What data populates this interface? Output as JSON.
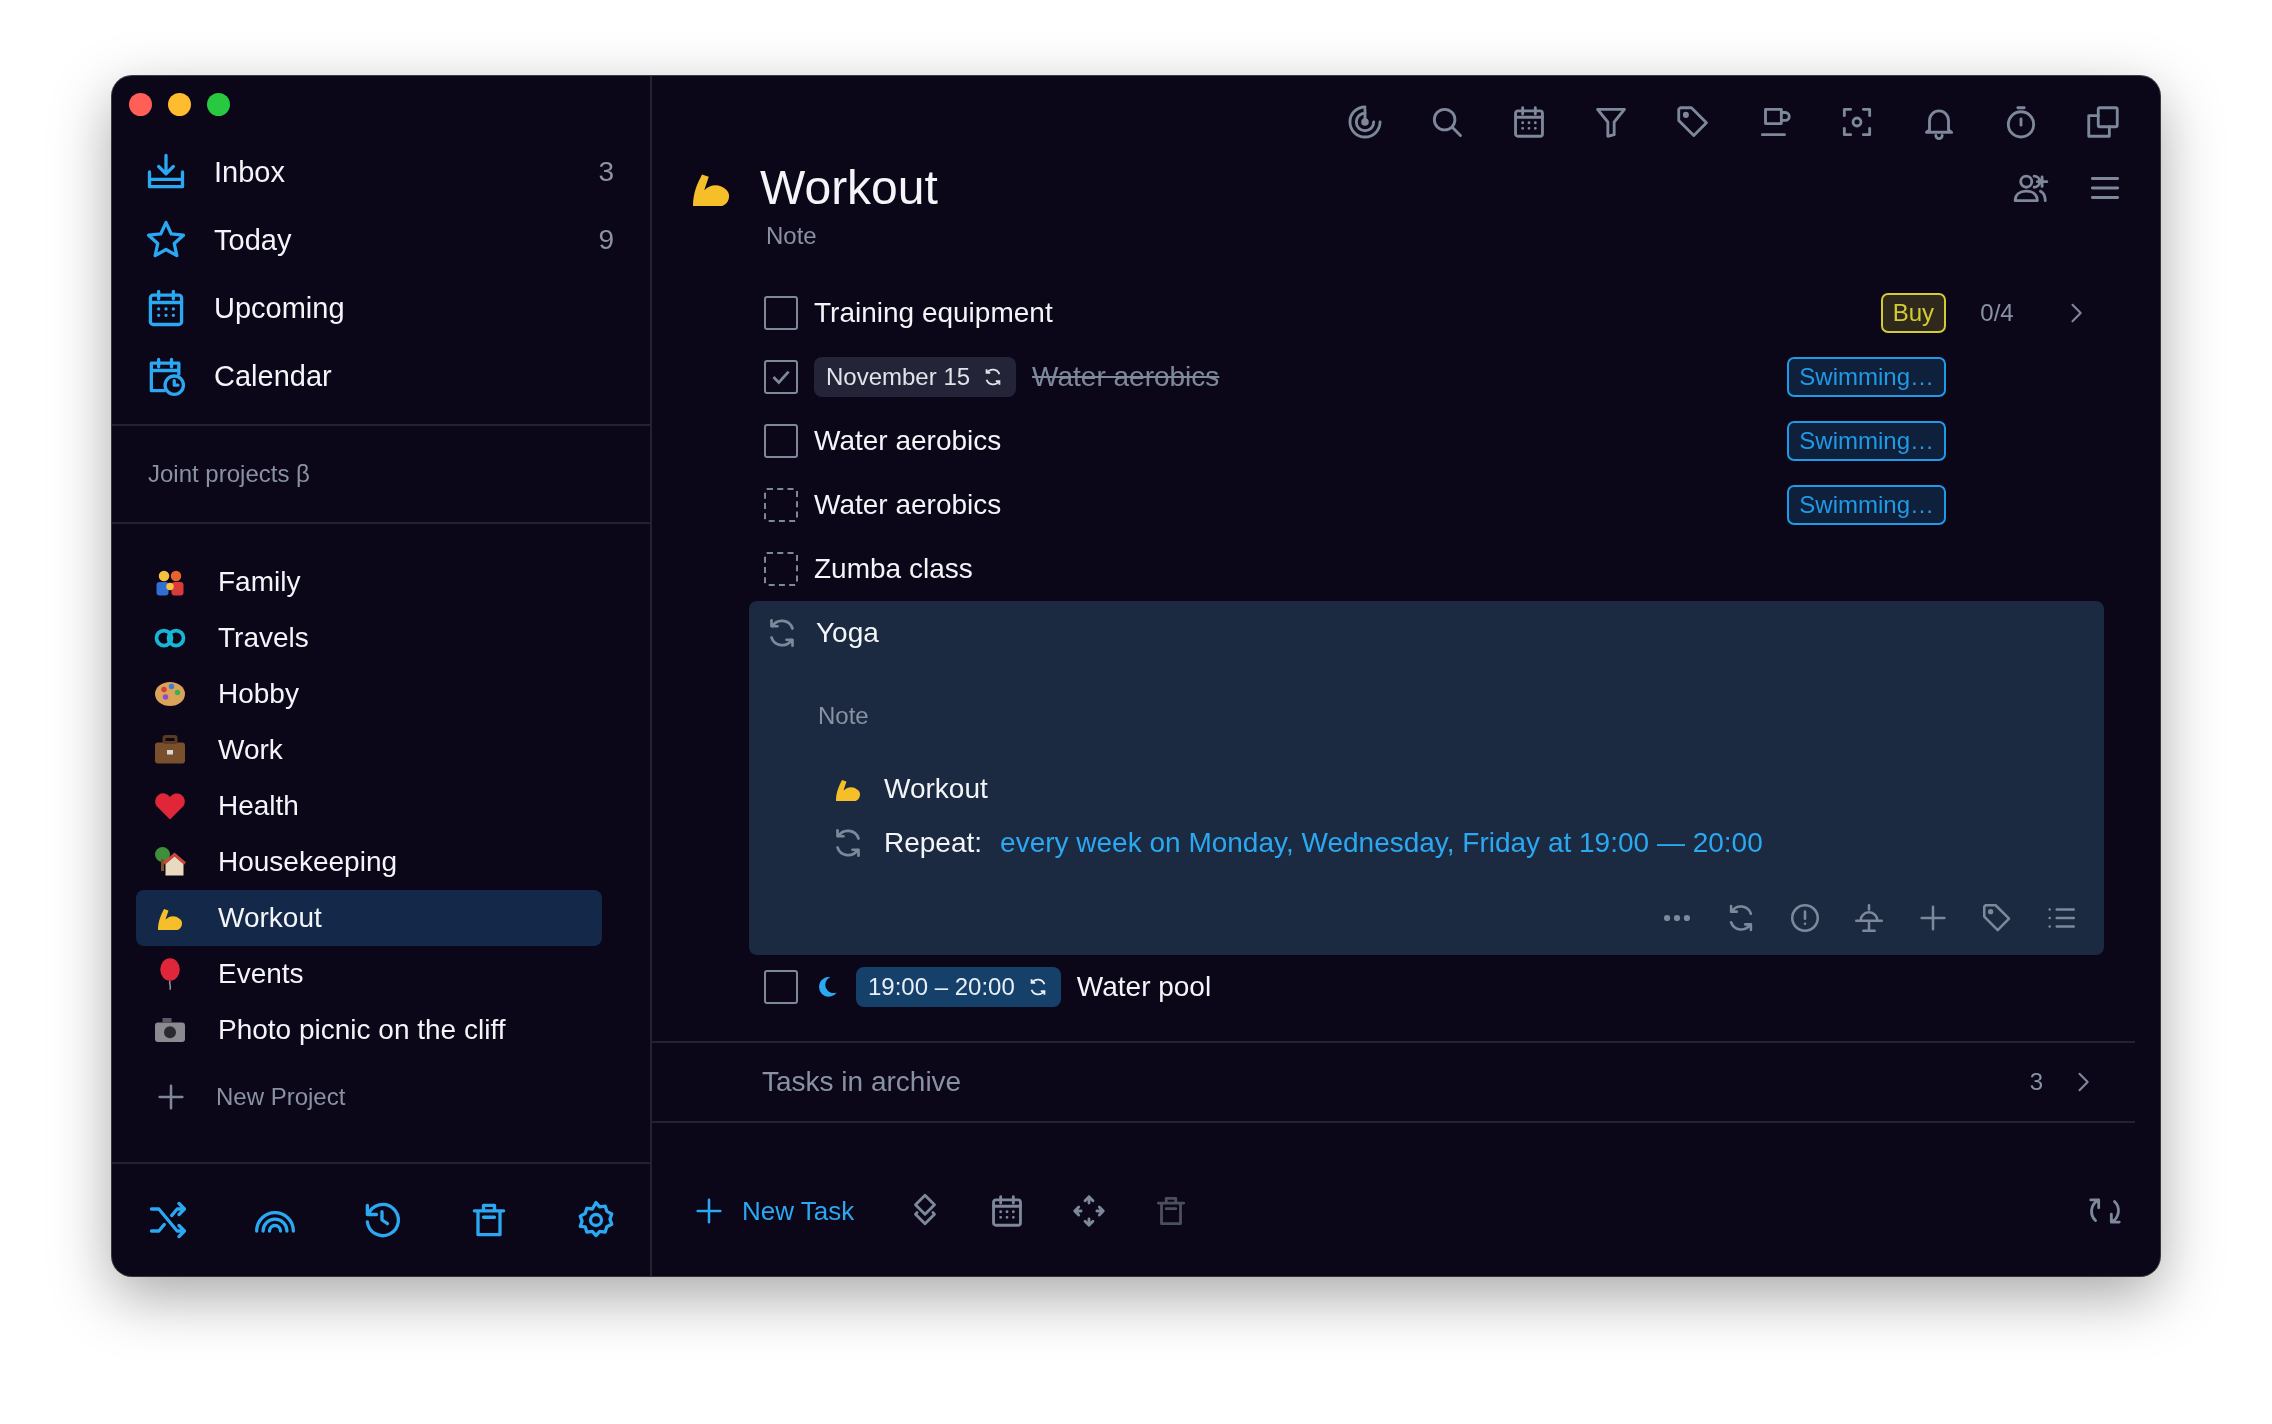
{
  "sidebar": {
    "nav": [
      {
        "label": "Inbox",
        "count": "3"
      },
      {
        "label": "Today",
        "count": "9"
      },
      {
        "label": "Upcoming"
      },
      {
        "label": "Calendar"
      }
    ],
    "joint_projects": "Joint projects β",
    "projects": [
      {
        "label": "Family",
        "selected": false
      },
      {
        "label": "Travels",
        "selected": false
      },
      {
        "label": "Hobby",
        "selected": false
      },
      {
        "label": "Work",
        "selected": false
      },
      {
        "label": "Health",
        "selected": false
      },
      {
        "label": "Housekeeping",
        "selected": false
      },
      {
        "label": "Workout",
        "selected": true
      },
      {
        "label": "Events",
        "selected": false
      },
      {
        "label": "Photo picnic on the cliff",
        "selected": false
      }
    ],
    "new_project": "New Project"
  },
  "project": {
    "title": "Workout",
    "note": {
      "placeholder": "Note"
    }
  },
  "tasks": [
    {
      "kind": "task",
      "checked": false,
      "title": "Training equipment",
      "tag": {
        "label": "Buy",
        "color": "#d2cb34"
      },
      "count": "0/4"
    },
    {
      "kind": "task",
      "checked": true,
      "date": "November 15",
      "repeating": true,
      "title": "Water aerobics",
      "tag": {
        "label": "Swimming…",
        "color": "#1f9ae6"
      }
    },
    {
      "kind": "task",
      "checked": false,
      "title": "Water aerobics",
      "tag": {
        "label": "Swimming…",
        "color": "#1f9ae6"
      }
    },
    {
      "kind": "someday",
      "checked": false,
      "title": "Water aerobics",
      "tag": {
        "label": "Swimming…",
        "color": "#1f9ae6"
      }
    },
    {
      "kind": "someday",
      "checked": false,
      "title": "Zumba class"
    },
    {
      "kind": "editing",
      "title": "Yoga",
      "note": {
        "placeholder": "Note"
      },
      "project": "Workout",
      "repeat_label": "Repeat:",
      "repeat": "every week on Monday, Wednesday, Friday at 19:00 — 20:00"
    },
    {
      "kind": "task",
      "checked": false,
      "evening": true,
      "time": "19:00 – 20:00",
      "repeating": true,
      "title": "Water pool"
    }
  ],
  "archive": {
    "label": "Tasks in archive",
    "count": "3"
  },
  "footer": {
    "new_task": "New Task"
  }
}
